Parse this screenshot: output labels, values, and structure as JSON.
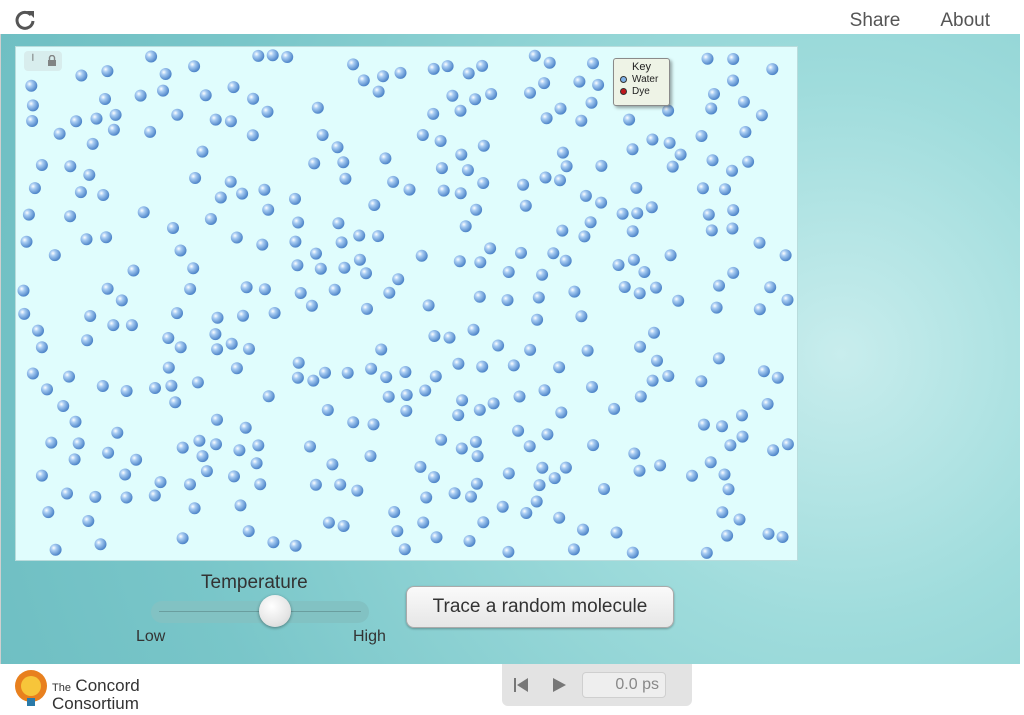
{
  "header": {
    "reload_icon": "reload-icon",
    "share_label": "Share",
    "about_label": "About"
  },
  "simulation": {
    "background_color": "#e0fdfd",
    "molecule_color": "#7fb1e8",
    "key": {
      "title": "Key",
      "items": [
        {
          "label": "Water",
          "color": "#7fb1e8"
        },
        {
          "label": "Dye",
          "color": "#c0161b"
        }
      ]
    }
  },
  "controls": {
    "temperature_label": "Temperature",
    "temperature_level": 0.58,
    "low_label": "Low",
    "high_label": "High",
    "trace_button_label": "Trace a random molecule"
  },
  "footer": {
    "logo_small": "The",
    "logo_line1": "Concord",
    "logo_line2": "Consortium",
    "time_display": "0.0 ps"
  }
}
